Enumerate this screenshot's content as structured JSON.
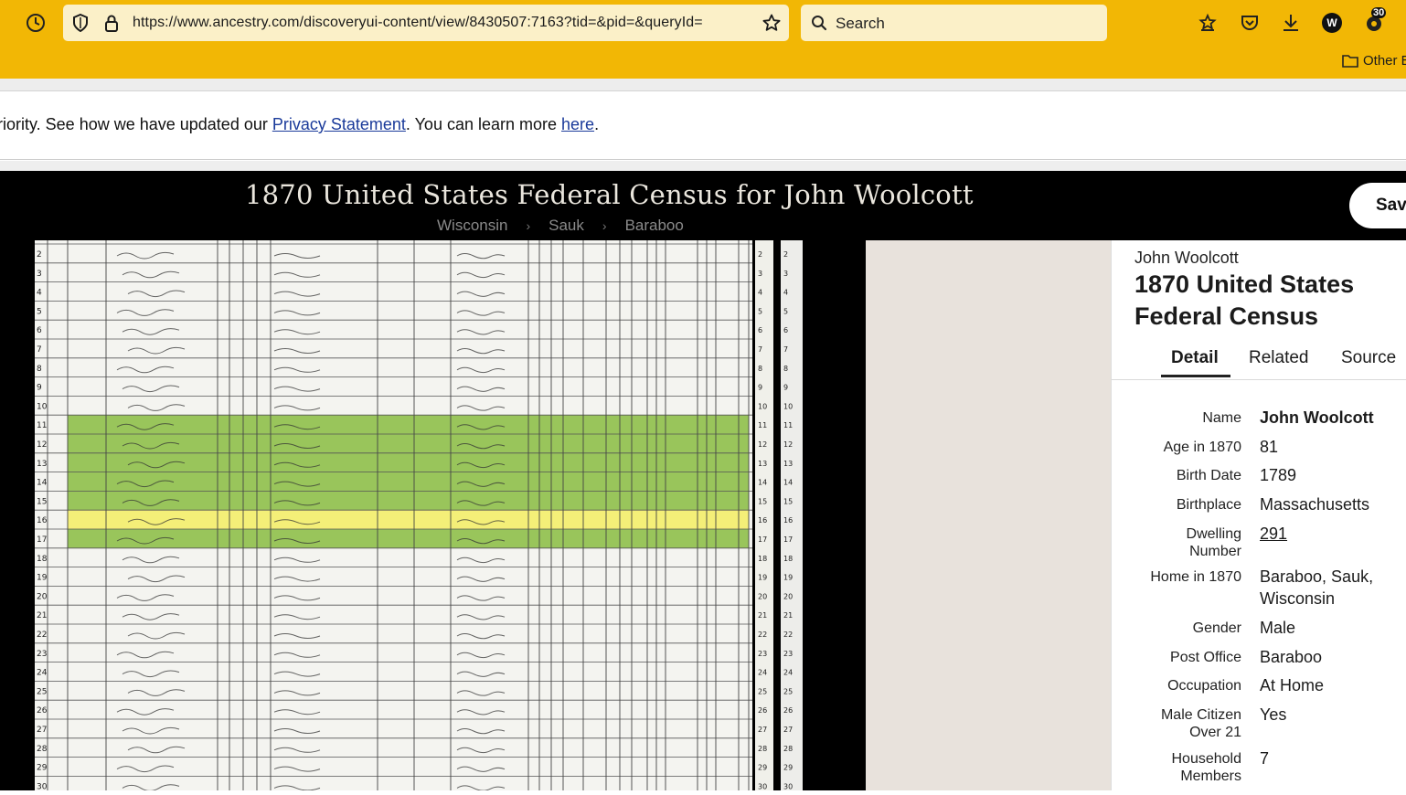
{
  "browser": {
    "url": "https://www.ancestry.com/discoveryui-content/view/8430507:7163?tid=&pid=&queryId=",
    "search_placeholder": "Search",
    "profile_initial": "W",
    "extensions_badge": "30",
    "bookmarks_other": "Other B"
  },
  "privacy_banner": {
    "lead": "riority. See how we have updated our ",
    "link1": "Privacy Statement",
    "mid": ". You can learn more ",
    "link2": "here",
    "tail": "."
  },
  "header": {
    "title": "1870 United States Federal Census for John Woolcott",
    "breadcrumb": [
      "Wisconsin",
      "Sauk",
      "Baraboo"
    ],
    "save_label": "Save"
  },
  "census_sheet": {
    "line_numbers": [
      "2",
      "3",
      "4",
      "5",
      "6",
      "7",
      "8",
      "9",
      "10",
      "11",
      "12",
      "13",
      "14",
      "15",
      "16",
      "17",
      "18",
      "19",
      "20",
      "21",
      "22",
      "23",
      "24",
      "25",
      "26",
      "27",
      "28",
      "29",
      "30"
    ],
    "highlight_green": "#8fc04a",
    "highlight_yellow": "#f4ee6a"
  },
  "panel": {
    "person_name": "John Woolcott",
    "collection": "1870 United States Federal Census",
    "tabs": [
      "Detail",
      "Related",
      "Source"
    ],
    "active_tab": "Detail",
    "facts": [
      {
        "label": "Name",
        "value": "John Woolcott"
      },
      {
        "label": "Age in 1870",
        "value": "81"
      },
      {
        "label": "Birth Date",
        "value": "1789"
      },
      {
        "label": "Birthplace",
        "value": "Massachusetts"
      },
      {
        "label": "Dwelling Number",
        "value": "291"
      },
      {
        "label": "Home in 1870",
        "value": "Baraboo, Sauk, Wisconsin"
      },
      {
        "label": "Gender",
        "value": "Male"
      },
      {
        "label": "Post Office",
        "value": "Baraboo"
      },
      {
        "label": "Occupation",
        "value": "At Home"
      },
      {
        "label": "Male Citizen Over 21",
        "value": "Yes"
      },
      {
        "label": "Household Members",
        "value": "7"
      }
    ]
  },
  "colors": {
    "toolbar": "#f2b705",
    "accent_dark": "#000000"
  }
}
